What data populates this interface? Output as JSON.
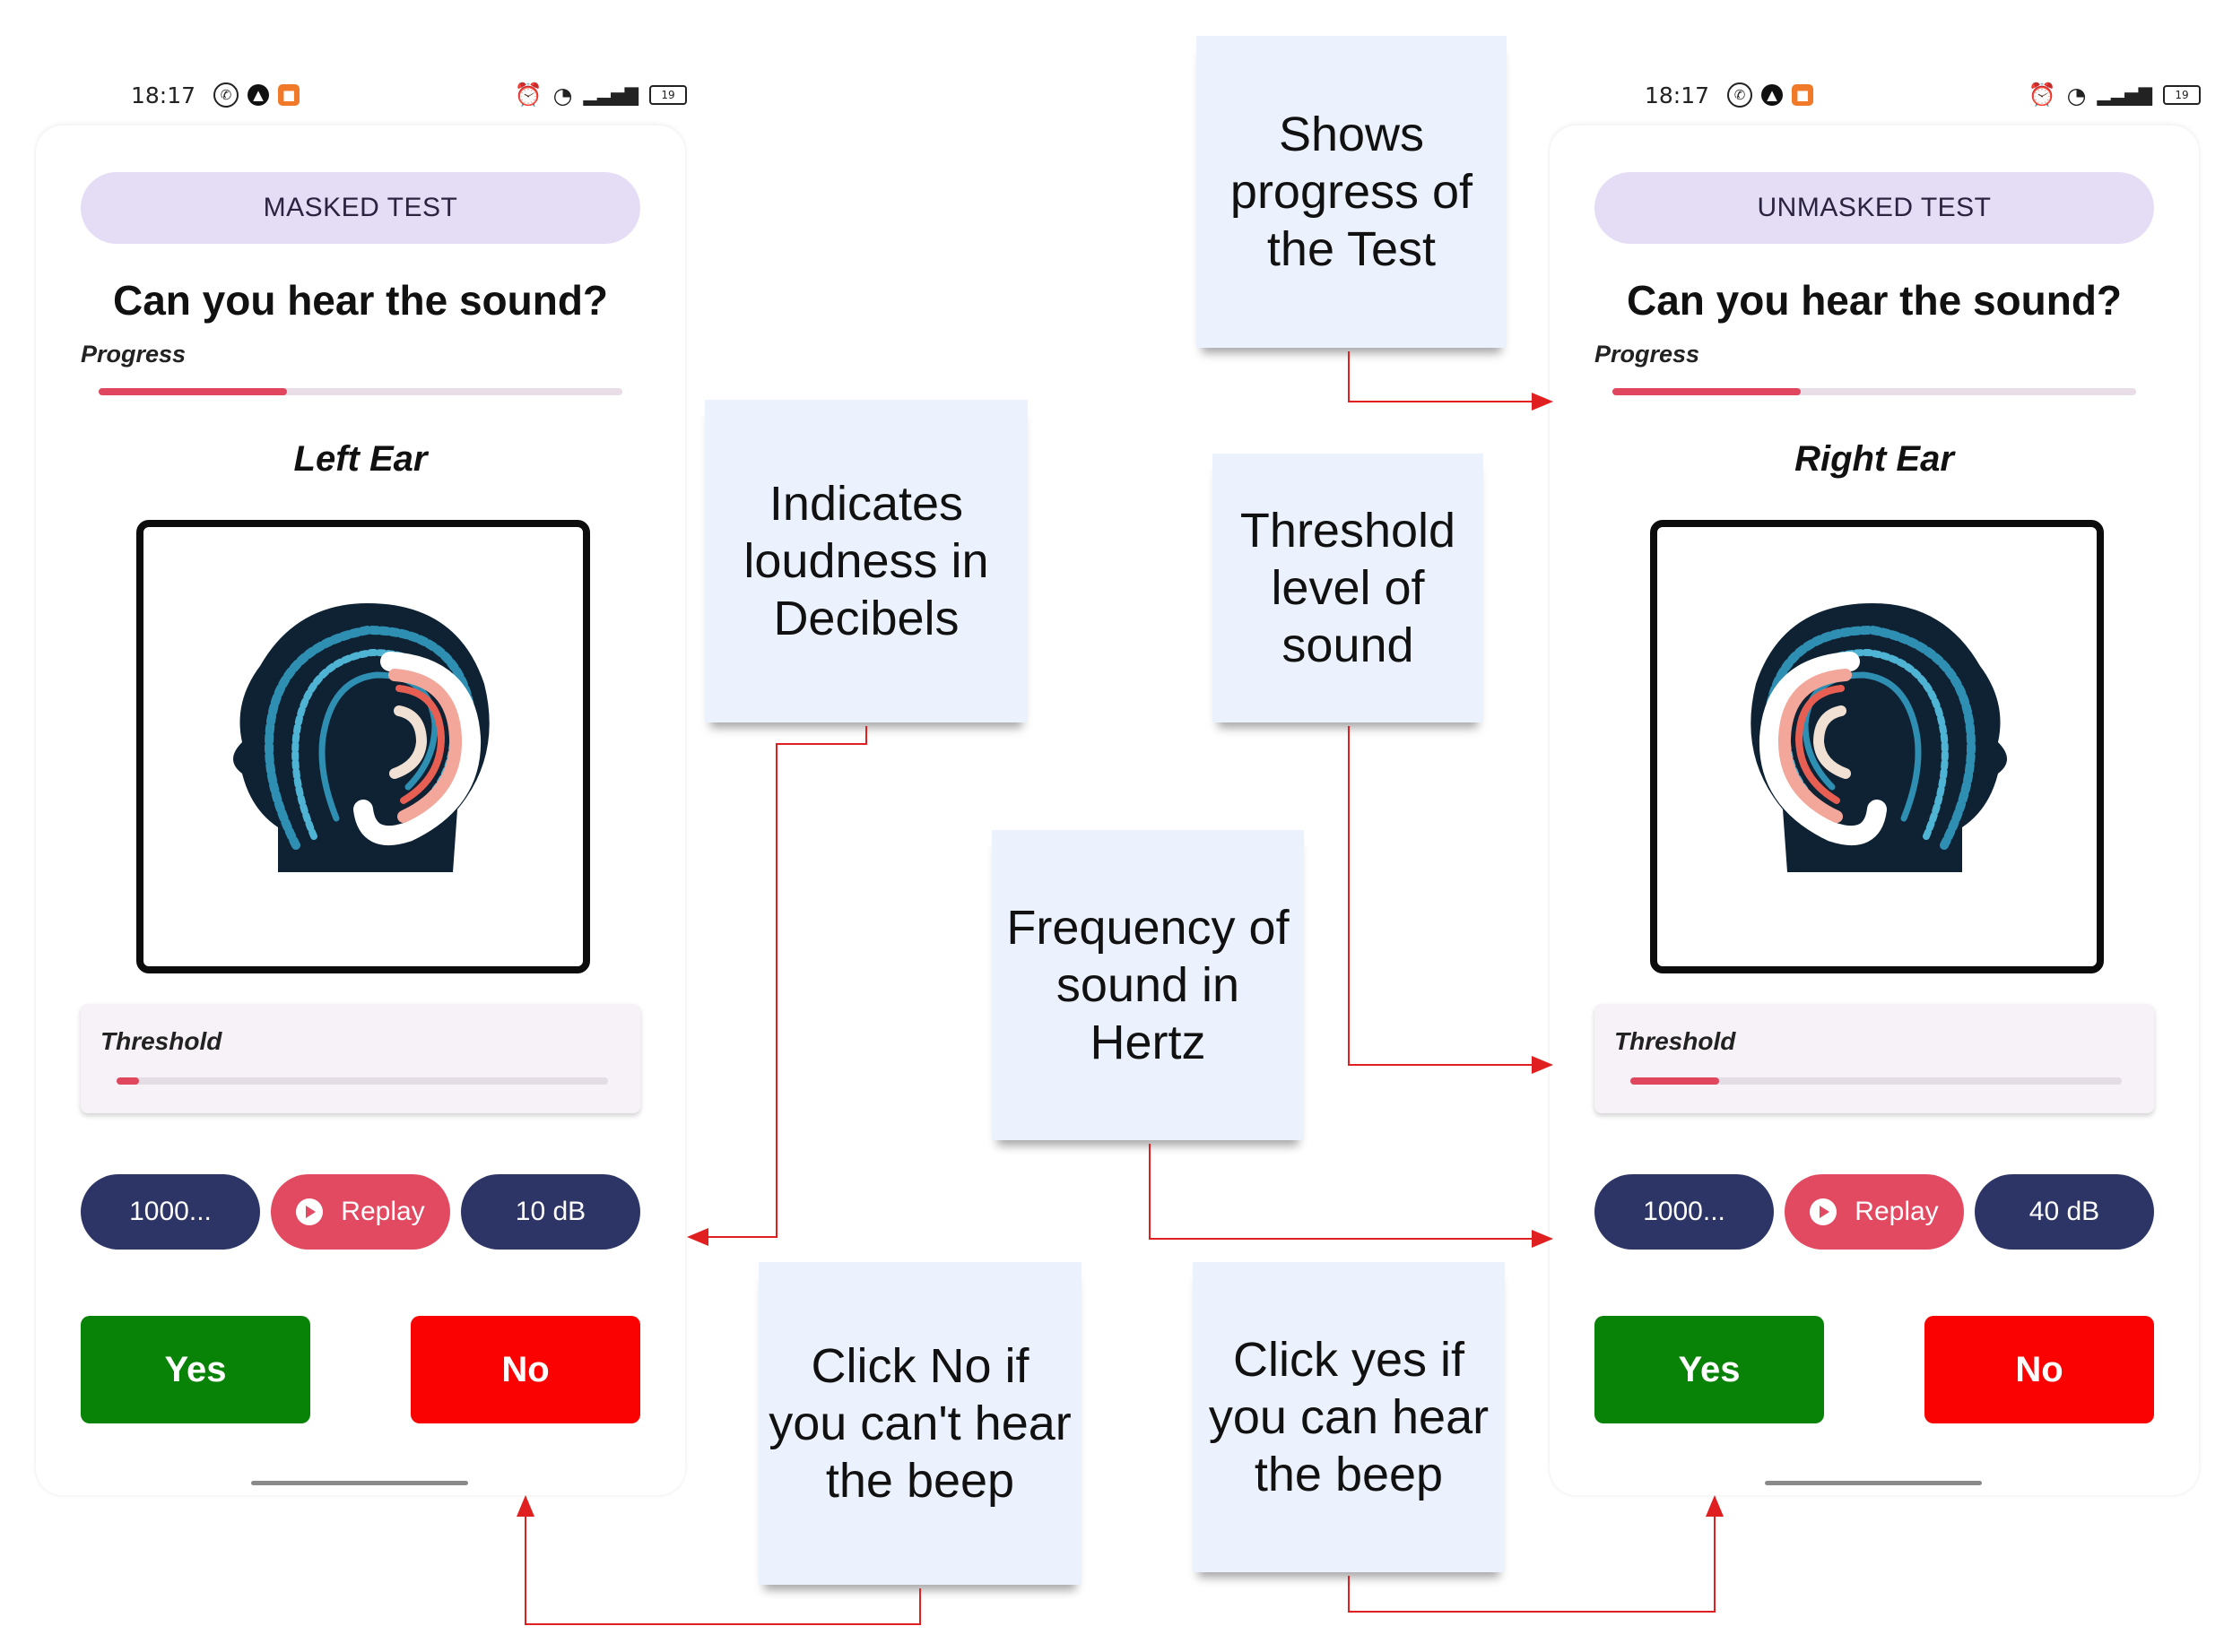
{
  "colors": {
    "pill_bg": "#e5dcf6",
    "progress_fill": "#e0475e",
    "chip_dark": "#2d3466",
    "chip_replay": "#e24a62",
    "yes": "#088308",
    "no": "#fb0202",
    "note_bg": "#ebf2fd",
    "arrow": "#e02020"
  },
  "left_phone": {
    "status": {
      "time": "18:17",
      "battery": "19"
    },
    "test_label": "MASKED TEST",
    "question": "Can you hear the sound?",
    "progress_label": "Progress",
    "progress_fraction": 0.36,
    "ear_label": "Left Ear",
    "ear_image": "head-with-ear-icon",
    "threshold_label": "Threshold",
    "threshold_fraction": 0.045,
    "frequency_chip": "1000...",
    "replay_label": "Replay",
    "db_chip": "10 dB",
    "yes_label": "Yes",
    "no_label": "No"
  },
  "right_phone": {
    "status": {
      "time": "18:17",
      "battery": "19"
    },
    "test_label": "UNMASKED TEST",
    "question": "Can you hear the sound?",
    "progress_label": "Progress",
    "progress_fraction": 0.36,
    "ear_label": "Right Ear",
    "ear_image": "head-with-ear-icon",
    "threshold_label": "Threshold",
    "threshold_fraction": 0.18,
    "frequency_chip": "1000...",
    "replay_label": "Replay",
    "db_chip": "40 dB",
    "yes_label": "Yes",
    "no_label": "No"
  },
  "annotations": {
    "progress": "Shows\nprogress of\nthe Test",
    "decibels": "Indicates\nloudness in\nDecibels",
    "threshold": "Threshold\nlevel of\nsound",
    "frequency": "Frequency of\nsound in\nHertz",
    "click_no": "Click No if\nyou can't hear\nthe beep",
    "click_yes": "Click yes if\nyou can hear\nthe beep"
  }
}
